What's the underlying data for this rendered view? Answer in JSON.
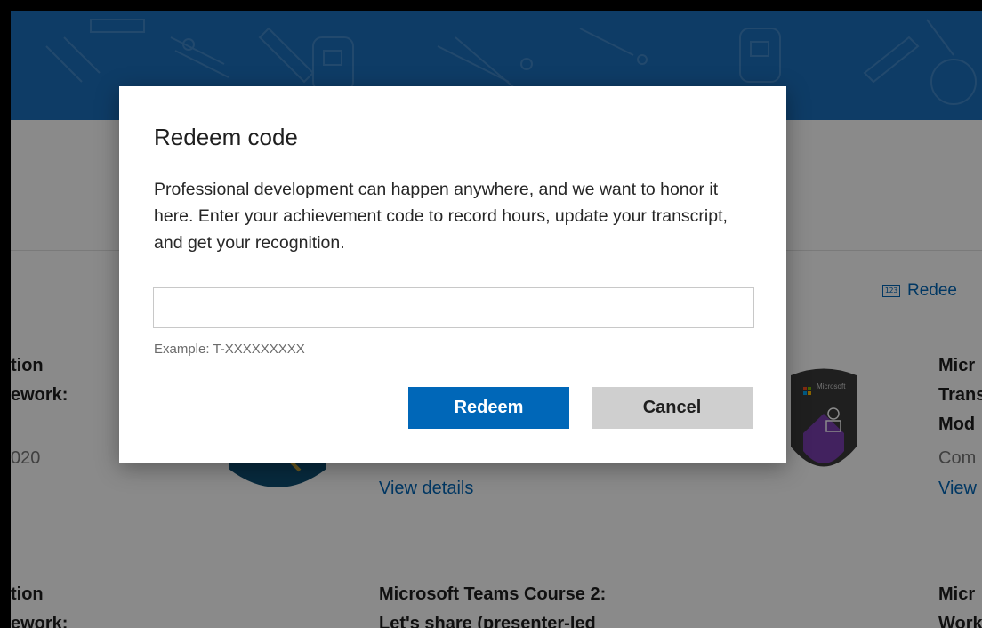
{
  "modal": {
    "title": "Redeem code",
    "description": "Professional development can happen anywhere, and we want to honor it here. Enter your achievement code to record hours, update your transcript, and get your recognition.",
    "input_value": "",
    "example_hint": "Example: T-XXXXXXXXX",
    "redeem_label": "Redeem",
    "cancel_label": "Cancel"
  },
  "page": {
    "redeem_link_icon": "123",
    "redeem_link_label": "Redee",
    "cards_row1": [
      {
        "title_lines": [
          "tion",
          "ework:"
        ],
        "date": "020"
      },
      {
        "link": "View details"
      },
      {
        "badge_brand": "Microsoft",
        "title_lines": [
          "Micr",
          "Trans",
          "Mod"
        ],
        "status": "Com",
        "link": "View"
      }
    ],
    "cards_row2": [
      {
        "title_lines": [
          "tion",
          "ework:"
        ]
      },
      {
        "title_lines": [
          "Microsoft Teams Course 2:",
          "Let's share (presenter-led"
        ]
      },
      {
        "title_lines": [
          "Micr",
          "Work"
        ]
      }
    ]
  },
  "colors": {
    "hero_blue": "#1a6fbd",
    "primary_button": "#0067b8",
    "secondary_button": "#cfcfcf",
    "link": "#0067b8",
    "badge_purple": "#7a3fb0"
  },
  "icons": {
    "redeem_link": "numeric-123-icon"
  }
}
